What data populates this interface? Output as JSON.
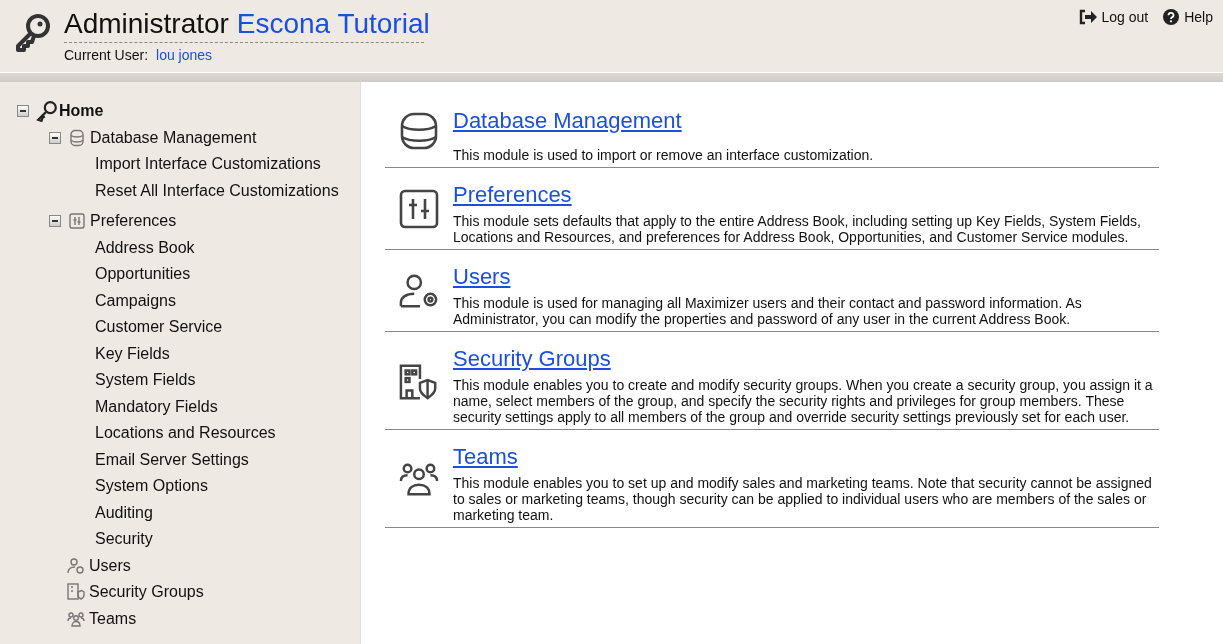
{
  "header": {
    "title": "Administrator",
    "database": "Escona Tutorial",
    "user_label": "Current User:",
    "user_name": "lou jones",
    "actions": [
      "Log out",
      "Help"
    ]
  },
  "sidebar": {
    "tree": [
      {
        "label": "Home",
        "expanded": true,
        "children": [
          {
            "label": "Database Management",
            "expanded": true,
            "children": [
              {
                "label": "Import Interface Customizations"
              },
              {
                "label": "Reset All Interface Customizations"
              }
            ]
          },
          {
            "label": "Preferences",
            "expanded": true,
            "children": [
              {
                "label": "Address Book"
              },
              {
                "label": "Opportunities"
              },
              {
                "label": "Campaigns"
              },
              {
                "label": "Customer Service"
              },
              {
                "label": "Key Fields"
              },
              {
                "label": "System Fields"
              },
              {
                "label": "Mandatory Fields"
              },
              {
                "label": "Locations and Resources"
              },
              {
                "label": "Email Server Settings"
              },
              {
                "label": "System Options"
              },
              {
                "label": "Auditing"
              },
              {
                "label": "Security"
              }
            ]
          },
          {
            "label": "Users"
          },
          {
            "label": "Security Groups"
          },
          {
            "label": "Teams"
          }
        ]
      }
    ]
  },
  "modules": [
    {
      "title": "Database Management",
      "description": "This module is used to import or remove an interface customization."
    },
    {
      "title": "Preferences",
      "description": "This module sets defaults that apply to the entire Address Book, including setting up Key Fields, System Fields, Locations and Resources, and preferences for Address Book, Opportunities, and Customer Service modules."
    },
    {
      "title": "Users",
      "description": "This module is used for managing all Maximizer users and their contact and password information. As Administrator, you can modify the properties and password of any user in the current Address Book."
    },
    {
      "title": "Security Groups",
      "description": "This module enables you to create and modify security groups. When you create a security group, you assign it a name, select members of the group, and specify the security rights and privileges for group members. These security settings apply to all members of the group and override security settings previously set for each user."
    },
    {
      "title": "Teams",
      "description": "This module enables you to set up and modify sales and marketing teams. Note that security cannot be assigned to sales or marketing teams, though security can be applied to individual users who are members of the sales or marketing team."
    }
  ]
}
